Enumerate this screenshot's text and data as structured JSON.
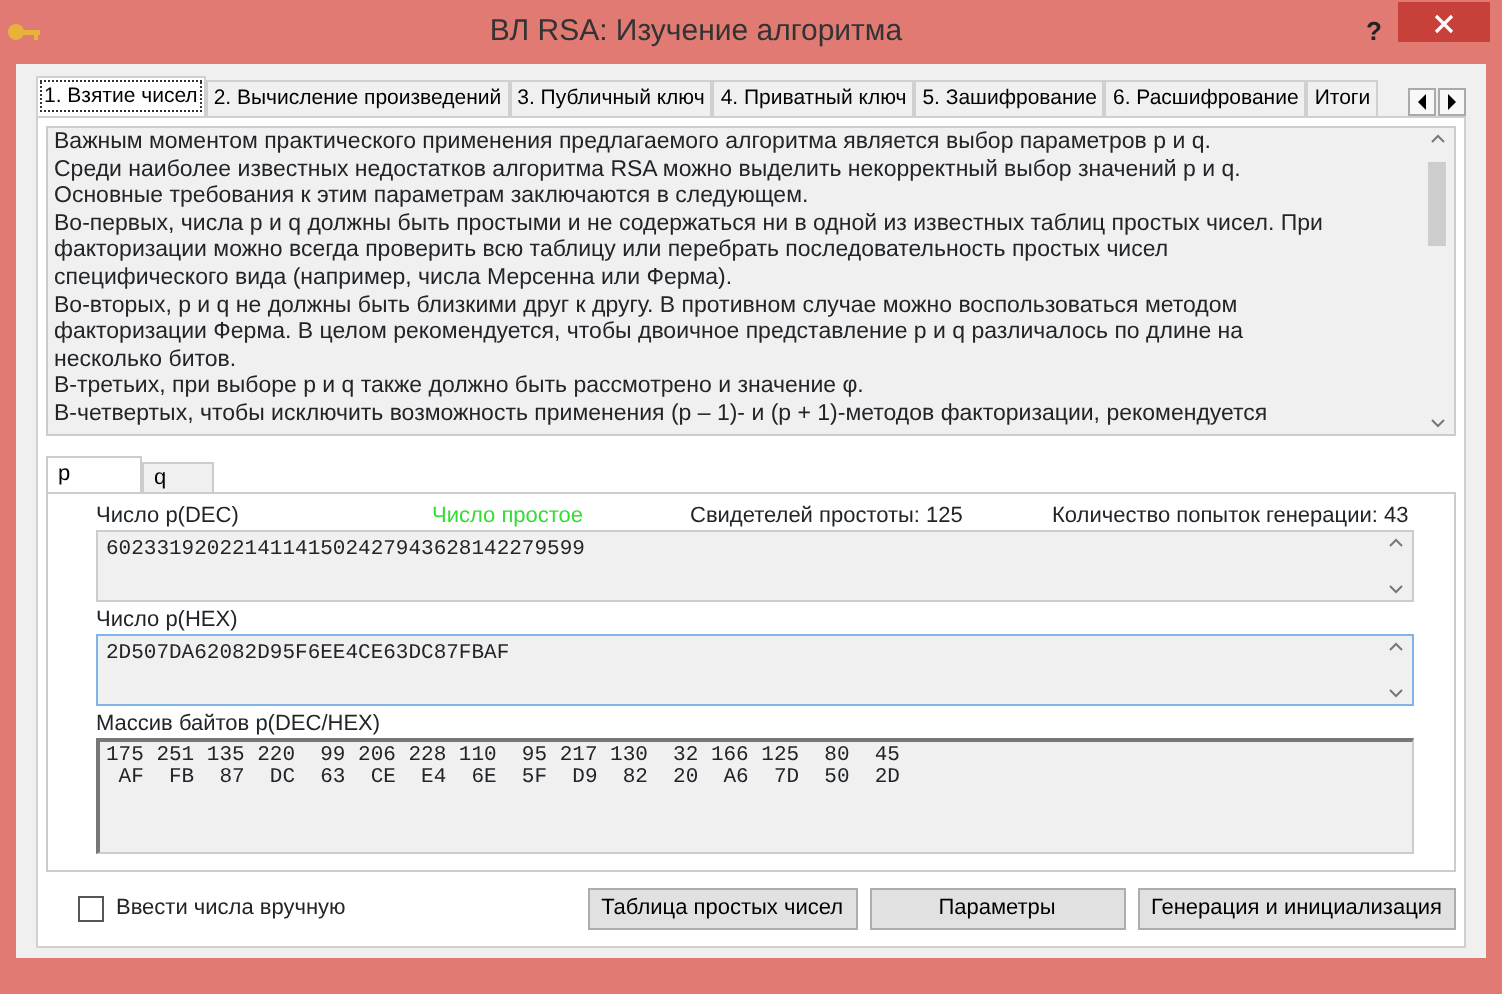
{
  "window": {
    "title": "ВЛ RSA: Изучение алгоритма",
    "help_button": "?"
  },
  "tabs": [
    {
      "label": "1. Взятие чисел",
      "selected": true
    },
    {
      "label": "2. Вычисление произведений",
      "selected": false
    },
    {
      "label": "3. Публичный ключ",
      "selected": false
    },
    {
      "label": "4. Приватный ключ",
      "selected": false
    },
    {
      "label": "5. Зашифрование",
      "selected": false
    },
    {
      "label": "6. Расшифрование",
      "selected": false
    },
    {
      "label": "Итоги",
      "selected": false
    }
  ],
  "description": [
    "Важным моментом практического применения предлагаемого алгоритма является выбор параметров p и q.",
    "Среди наиболее известных недостатков алгоритма RSA можно выделить некорректный выбор значений p и q.",
    "Основные требования к этим параметрам заключаются в следующем.",
    "Во-первых, числа p и q должны быть простыми и не содержаться ни в одной из известных таблиц простых чисел. При",
    "факторизации можно всегда проверить всю таблицу или перебрать последовательность простых чисел",
    "специфического вида (например, числа Мерсенна или Ферма).",
    "Во-вторых, p и q не должны быть близкими друг к другу. В противном случае можно воспользоваться методом",
    "факторизации Ферма. В целом рекомендуется, чтобы двоичное представление p и q различалось по длине на",
    "несколько битов.",
    "В-третьих, при выборе p и q также должно быть рассмотрено и значение φ.",
    "В-четвертых, чтобы исключить возможность применения (p – 1)- и (p + 1)-методов факторизации, рекомендуется"
  ],
  "number_tabs": [
    {
      "label": "p",
      "selected": true
    },
    {
      "label": "q",
      "selected": false
    }
  ],
  "dec_field": {
    "label": "Число p(DEC)",
    "value": "60233192022141141502427943628142279599",
    "focused": false
  },
  "prime_status": "Число простое",
  "witnesses": "Свидетелей простоты: 125",
  "attempts": "Количество попыток генерации: 43",
  "hex_field": {
    "label": "Число p(HEX)",
    "value": "2D507DA62082D95F6EE4CE63DC87FBAF",
    "focused": true
  },
  "bytes": {
    "label": "Массив байтов p(DEC/HEX)",
    "rows": [
      "175 251 135 220  99 206 228 110  95 217 130  32 166 125  80  45",
      " AF  FB  87  DC  63  CE  E4  6E  5F  D9  82  20  A6  7D  50  2D"
    ]
  },
  "manual_entry": {
    "label": "Ввести числа вручную",
    "checked": false
  },
  "buttons": [
    "Таблица простых чисел",
    "Параметры",
    "Генерация и инициализация"
  ]
}
